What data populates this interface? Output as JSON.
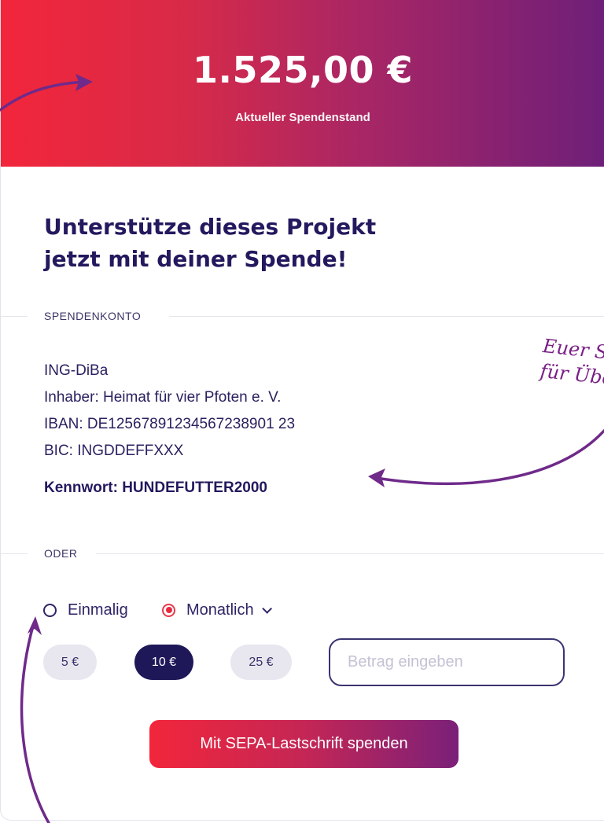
{
  "hero": {
    "amount": "1.525,00 €",
    "label": "Aktueller Spendenstand"
  },
  "headline": {
    "line1": "Unterstütze dieses Projekt",
    "line2": "jetzt mit deiner Spende!"
  },
  "bank_section": {
    "heading": "SPENDENKONTO",
    "bank_name": "ING-DiBa",
    "holder": "Inhaber: Heimat für vier Pfoten e. V.",
    "iban": "IBAN: DE12567891234567238901 23",
    "bic": "BIC: INGDDEFFXXX",
    "keyword": "Kennwort: HUNDEFUTTER2000"
  },
  "annotation": {
    "line1": "Euer S",
    "line2": "für Übe"
  },
  "or_divider": "ODER",
  "frequency": {
    "options": [
      {
        "label": "Einmalig",
        "checked": false
      },
      {
        "label": "Monatlich",
        "checked": true
      }
    ]
  },
  "amount_presets": [
    {
      "label": "5 €",
      "selected": false
    },
    {
      "label": "10 €",
      "selected": true
    },
    {
      "label": "25 €",
      "selected": false
    }
  ],
  "amount_input": {
    "placeholder": "Betrag eingeben",
    "value": ""
  },
  "cta": {
    "label": "Mit SEPA-Lastschrift spenden"
  },
  "colors": {
    "gradient_start": "#f2263b",
    "gradient_end": "#6e1f79",
    "navy": "#23195e",
    "annotation": "#7a1f86",
    "selected_pill": "#1e1858",
    "pill": "#e8e7f0"
  }
}
